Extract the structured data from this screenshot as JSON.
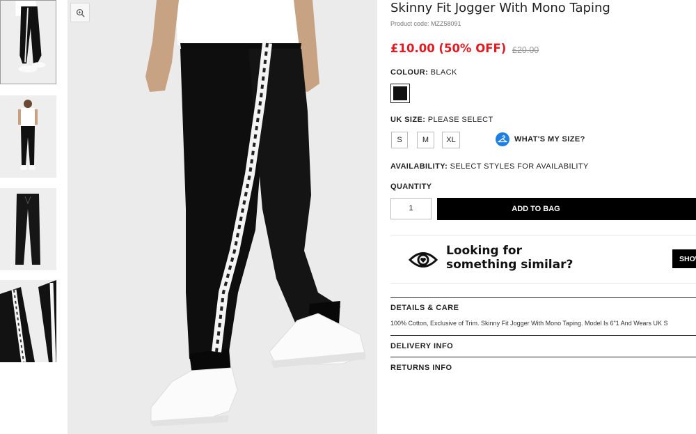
{
  "product": {
    "title": "Skinny Fit Jogger With Mono Taping",
    "product_code": "Product code: MZZ58091",
    "price": "£10.00 (50% OFF)",
    "old_price": "£20.00"
  },
  "colour": {
    "label": "COLOUR:",
    "value": "BLACK",
    "swatch": "#111111"
  },
  "size": {
    "label": "UK SIZE:",
    "value": "PLEASE SELECT",
    "options": [
      "S",
      "M",
      "XL"
    ],
    "guide_label": "WHAT'S MY SIZE?"
  },
  "availability": {
    "label": "AVAILABILITY:",
    "value": "SELECT STYLES FOR AVAILABILITY"
  },
  "quantity": {
    "label": "QUANTITY",
    "value": "1"
  },
  "add_to_bag": "ADD TO BAG",
  "similar": {
    "text": "Looking for something similar?",
    "button": "SHOW"
  },
  "details": {
    "title": "DETAILS & CARE",
    "text": "100% Cotton, Exclusive of Trim. Skinny Fit Jogger With Mono Taping. Model Is 6\"1 And Wears UK S"
  },
  "delivery": {
    "title": "DELIVERY INFO"
  },
  "returns": {
    "title": "RETURNS INFO"
  },
  "colors": {
    "price_red": "#e01b22",
    "accent_blue": "#1f7fe0",
    "black": "#000000"
  }
}
